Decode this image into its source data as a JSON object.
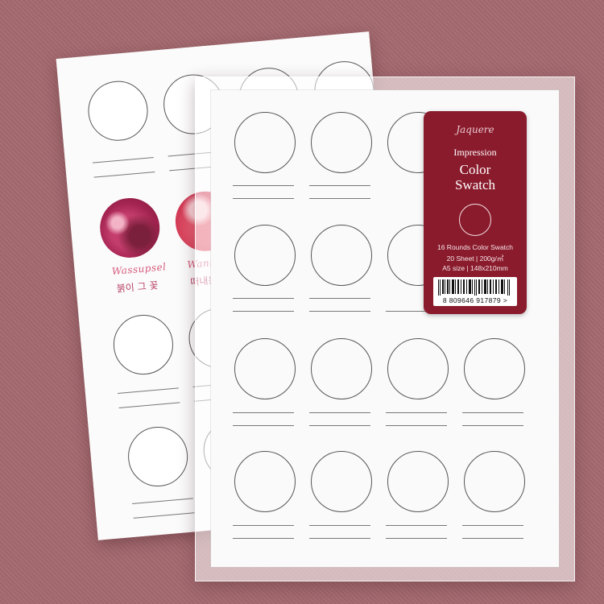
{
  "scene": {
    "background_color": "#a46a70",
    "label_color": "#8a1b2c"
  },
  "back_sheet": {
    "swatch_labels": [
      {
        "script": "Wassupsel",
        "hangul": "붉이 그 꽃"
      },
      {
        "script": "Wann",
        "hangul": "떠내는"
      }
    ]
  },
  "label": {
    "brand": "Jaquere",
    "series": "Impression",
    "title_line1": "Color",
    "title_line2": "Swatch",
    "spec_line1": "16 Rounds Color Swatch",
    "spec_line2": "20 Sheet | 200g/㎡",
    "spec_line3": "A5 size | 148x210mm",
    "barcode_digits": "8  809646  917879  >"
  }
}
